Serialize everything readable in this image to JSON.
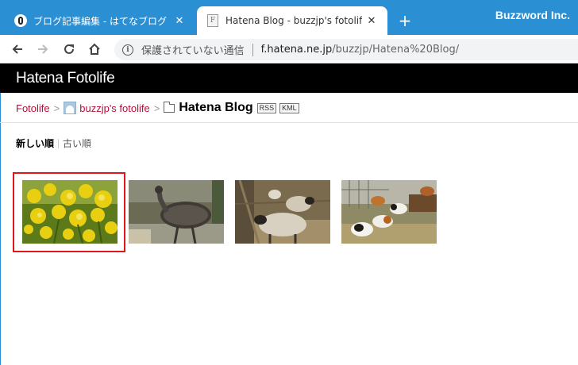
{
  "browser": {
    "tabs": [
      {
        "title": "ブログ記事編集 - はてなブログ",
        "active": false
      },
      {
        "title": "Hatena Blog - buzzjp's fotolife",
        "active": true
      }
    ],
    "close_glyph": "✕",
    "new_tab_glyph": "+",
    "watermark": "Buzzword Inc.",
    "address": {
      "security_text": "保護されていない通信",
      "url_host": "f.hatena.ne.jp",
      "url_path": "/buzzjp/Hatena%20Blog/"
    }
  },
  "site": {
    "logo": "Hatena Fotolife",
    "breadcrumb": {
      "root": "Fotolife",
      "separator": ">",
      "user": "buzzjp's fotolife",
      "current": "Hatena Blog",
      "badges": [
        "RSS",
        "KML"
      ]
    },
    "sort": {
      "newest": "新しい順",
      "oldest": "古い順"
    },
    "photos": [
      {
        "subject": "rapeseed-flowers",
        "selected": true
      },
      {
        "subject": "emu",
        "selected": false
      },
      {
        "subject": "sheep",
        "selected": false
      },
      {
        "subject": "guinea-pigs",
        "selected": false
      }
    ]
  },
  "colors": {
    "tabstrip": "#2a8fd3",
    "link": "#b5123b",
    "highlight": "#e0161c",
    "header": "#000000"
  }
}
